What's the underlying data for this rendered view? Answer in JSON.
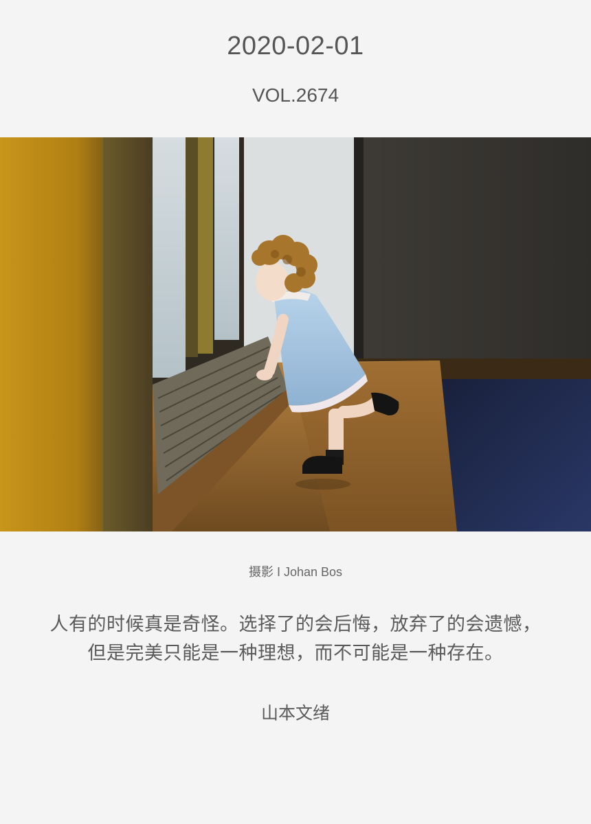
{
  "header": {
    "date": "2020-02-01",
    "volume": "VOL.2674"
  },
  "photo": {
    "credit": "摄影 I Johan Bos",
    "colors": {
      "yellow_wall": "#b8860b",
      "window_glass": "#c9d6dc",
      "wood_floor": "#9a6a2e",
      "dark_floor": "#1f2a44",
      "dress": "#a9c8e3"
    }
  },
  "quote": {
    "line1": "人有的时候真是奇怪。选择了的会后悔，放弃了的会遗憾，",
    "line2": "但是完美只能是一种理想，而不可能是一种存在。"
  },
  "author": "山本文绪"
}
